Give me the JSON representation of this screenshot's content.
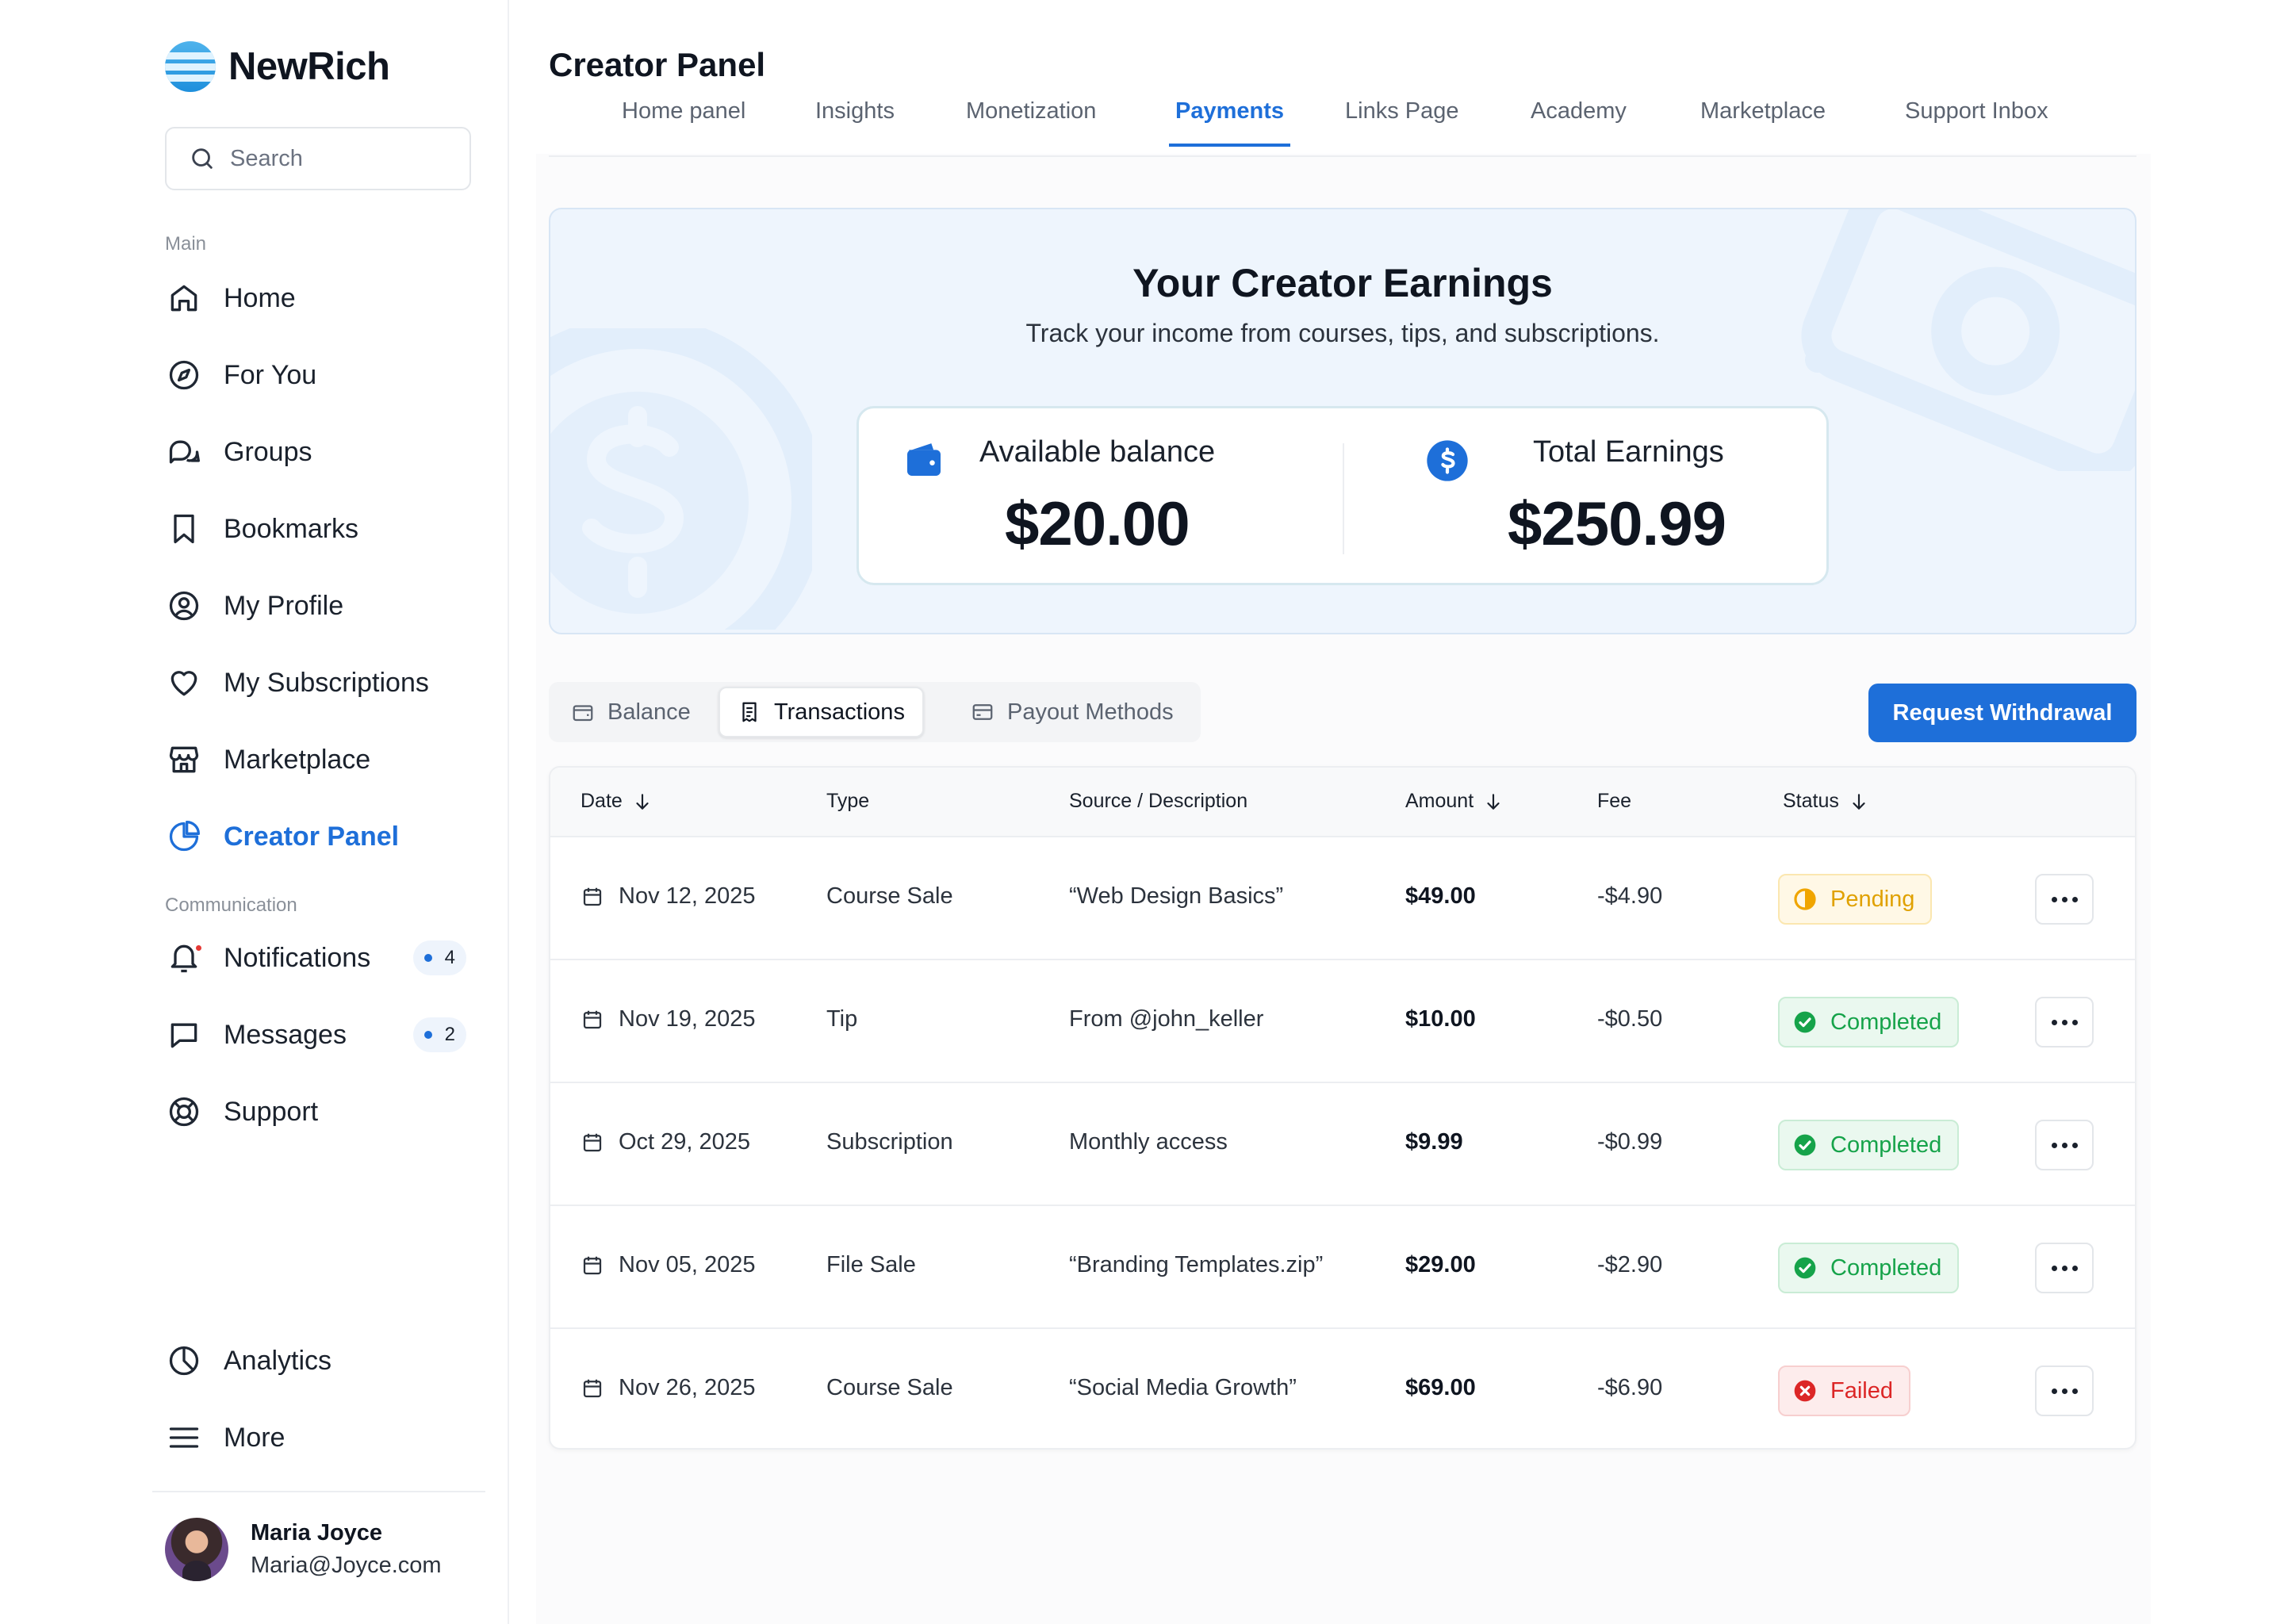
{
  "app": {
    "name": "NewRich"
  },
  "search": {
    "placeholder": "Search"
  },
  "sidebar": {
    "main_label": "Main",
    "main_items": [
      {
        "label": "Home",
        "icon": "home-icon"
      },
      {
        "label": "For You",
        "icon": "compass-icon"
      },
      {
        "label": "Groups",
        "icon": "chat-bubbles-icon"
      },
      {
        "label": "Bookmarks",
        "icon": "bookmark-icon"
      },
      {
        "label": "My Profile",
        "icon": "user-circle-icon"
      },
      {
        "label": "My Subscriptions",
        "icon": "heart-icon"
      },
      {
        "label": "Marketplace",
        "icon": "storefront-icon"
      },
      {
        "label": "Creator Panel",
        "icon": "pie-chart-icon",
        "active": true
      }
    ],
    "communication_label": "Communication",
    "communication_items": [
      {
        "label": "Notifications",
        "icon": "bell-icon",
        "count": "4"
      },
      {
        "label": "Messages",
        "icon": "message-icon",
        "count": "2"
      },
      {
        "label": "Support",
        "icon": "lifebuoy-icon"
      }
    ],
    "bottom_items": [
      {
        "label": "Analytics",
        "icon": "pie-chart-icon"
      },
      {
        "label": "More",
        "icon": "menu-icon"
      }
    ],
    "user": {
      "name": "Maria Joyce",
      "email": "Maria@Joyce.com"
    }
  },
  "header": {
    "title": "Creator Panel",
    "tabs": [
      "Home panel",
      "Insights",
      "Monetization",
      "Payments",
      "Links Page",
      "Academy",
      "Marketplace",
      "Support Inbox"
    ],
    "active_tab": "Payments"
  },
  "hero": {
    "title": "Your Creator Earnings",
    "subtitle": "Track your income from courses, tips, and subscriptions.",
    "available_label": "Available balance",
    "available_value": "$20.00",
    "total_label": "Total Earnings",
    "total_value": "$250.99"
  },
  "segments": {
    "items": [
      "Balance",
      "Transactions",
      "Payout Methods"
    ],
    "active": "Transactions"
  },
  "actions": {
    "request_withdrawal": "Request Withdrawal"
  },
  "table": {
    "columns": {
      "date": "Date",
      "type": "Type",
      "source": "Source / Description",
      "amount": "Amount",
      "fee": "Fee",
      "status": "Status"
    },
    "rows": [
      {
        "date": "Nov 12, 2025",
        "type": "Course Sale",
        "source": "“Web Design Basics”",
        "amount": "$49.00",
        "fee": "-$4.90",
        "status": "Pending"
      },
      {
        "date": "Nov 19, 2025",
        "type": "Tip",
        "source": "From @john_keller",
        "amount": "$10.00",
        "fee": "-$0.50",
        "status": "Completed"
      },
      {
        "date": "Oct 29, 2025",
        "type": "Subscription",
        "source": "Monthly access",
        "amount": "$9.99",
        "fee": "-$0.99",
        "status": "Completed"
      },
      {
        "date": "Nov 05, 2025",
        "type": "File Sale",
        "source": "“Branding Templates.zip”",
        "amount": "$29.00",
        "fee": "-$2.90",
        "status": "Completed"
      },
      {
        "date": "Nov 26, 2025",
        "type": "Course Sale",
        "source": "“Social Media Growth”",
        "amount": "$69.00",
        "fee": "-$6.90",
        "status": "Failed"
      }
    ]
  },
  "colors": {
    "accent": "#1e6fd9",
    "pending": "#e0a100",
    "completed": "#16a34a",
    "failed": "#dc2626"
  }
}
